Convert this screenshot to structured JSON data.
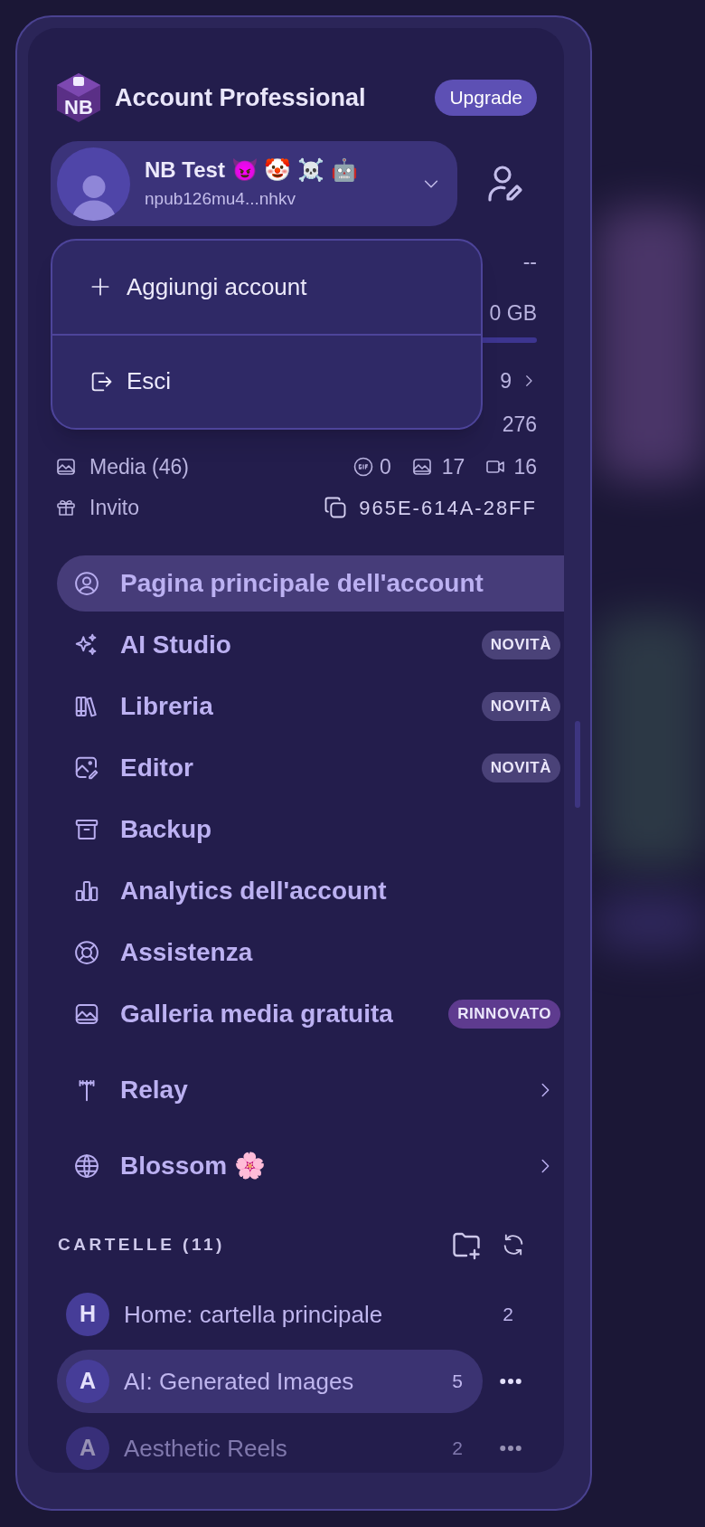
{
  "header": {
    "logo": "NB",
    "title": "Account Professional",
    "upgrade_button": "Upgrade"
  },
  "account": {
    "name": "NB Test 😈 🤡 ☠️ 🤖",
    "npub": "npub126mu4...nhkv",
    "expanded": true
  },
  "account_menu": [
    {
      "kind": "add",
      "label": "Aggiungi account"
    },
    {
      "kind": "logout",
      "label": "Esci"
    }
  ],
  "stats": {
    "row_1_value": "--",
    "storage_value": "0 GB",
    "row_3_value": "9",
    "days_value": "276"
  },
  "media": {
    "label": "Media (46)",
    "gif_count": "0",
    "image_count": "17",
    "video_count": "16"
  },
  "invite": {
    "label": "Invito",
    "code": "965E-614A-28FF"
  },
  "nav": [
    {
      "label": "Pagina principale dell'account",
      "selected": true
    },
    {
      "label": "AI Studio",
      "selected": false,
      "badge": {
        "text": "NOVITÀ",
        "color": "#4a4278"
      }
    },
    {
      "label": "Libreria",
      "selected": false,
      "badge": {
        "text": "NOVITÀ",
        "color": "#4a4278"
      }
    },
    {
      "label": "Editor",
      "selected": false,
      "badge": {
        "text": "NOVITÀ",
        "color": "#4a4278"
      }
    },
    {
      "label": "Backup",
      "selected": false
    },
    {
      "label": "Analytics dell'account",
      "selected": false
    },
    {
      "label": "Assistenza",
      "selected": false
    },
    {
      "label": "Galleria media gratuita",
      "selected": false,
      "badge": {
        "text": "RINNOVATO",
        "color": "#5e3b8f"
      }
    }
  ],
  "network_nav": [
    {
      "label": "Relay"
    },
    {
      "label": "Blossom 🌸"
    }
  ],
  "folders": {
    "title": "CARTELLE (11)",
    "items": [
      {
        "initial": "H",
        "name": "Home: cartella principale",
        "count": "2",
        "selected": false,
        "menu_button": false,
        "faded": false
      },
      {
        "initial": "A",
        "name": "AI: Generated Images",
        "count": "5",
        "selected": true,
        "menu_button": true,
        "faded": false
      },
      {
        "initial": "A",
        "name": "Aesthetic Reels",
        "count": "2",
        "selected": false,
        "menu_button": true,
        "faded": true
      }
    ]
  }
}
